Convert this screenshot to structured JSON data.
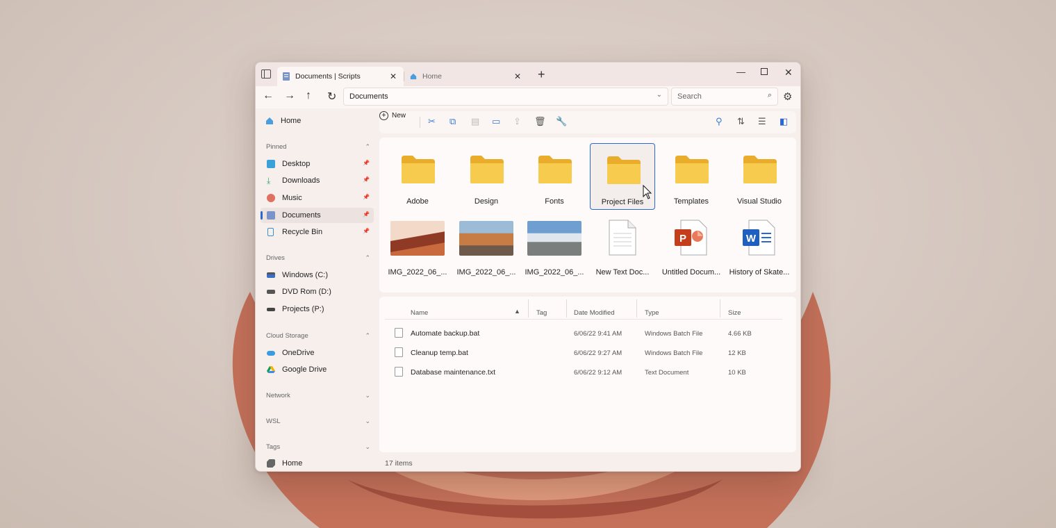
{
  "tabs": [
    {
      "label": "Documents | Scripts",
      "icon": "documents-icon"
    },
    {
      "label": "Home",
      "icon": "home-icon"
    }
  ],
  "address": {
    "path": "Documents"
  },
  "search": {
    "placeholder": "Search"
  },
  "sidebar": {
    "home": "Home",
    "pinned_label": "Pinned",
    "pinned": [
      "Desktop",
      "Downloads",
      "Music",
      "Documents",
      "Recycle Bin"
    ],
    "drives_label": "Drives",
    "drives": [
      "Windows (C:)",
      "DVD Rom (D:)",
      "Projects (P:)"
    ],
    "cloud_label": "Cloud Storage",
    "cloud": [
      "OneDrive",
      "Google Drive"
    ],
    "network_label": "Network",
    "wsl_label": "WSL",
    "tags_label": "Tags",
    "tags": [
      "Home"
    ]
  },
  "toolbar": {
    "new_label": "New"
  },
  "grid": {
    "folders": [
      "Adobe",
      "Design",
      "Fonts",
      "Project Files",
      "Templates",
      "Visual Studio"
    ],
    "files": [
      "IMG_2022_06_...",
      "IMG_2022_06_...",
      "IMG_2022_06_...",
      "New Text Doc...",
      "Untitled Docum...",
      "History of Skate..."
    ],
    "selected": "Project Files"
  },
  "list": {
    "columns": [
      "Name",
      "Tag",
      "Date Modified",
      "Type",
      "Size"
    ],
    "rows": [
      {
        "name": "Automate backup.bat",
        "date": "6/06/22 9:41 AM",
        "type": "Windows Batch File",
        "size": "4.66 KB"
      },
      {
        "name": "Cleanup temp.bat",
        "date": "6/06/22 9:27 AM",
        "type": "Windows Batch File",
        "size": "12 KB"
      },
      {
        "name": "Database maintenance.txt",
        "date": "6/06/22 9:12 AM",
        "type": "Text Document",
        "size": "10 KB"
      }
    ]
  },
  "status": {
    "count": "17 items"
  },
  "colors": {
    "accent": "#2b67d1",
    "folder": "#f7cb4d",
    "window_bg": "#f6efec"
  }
}
